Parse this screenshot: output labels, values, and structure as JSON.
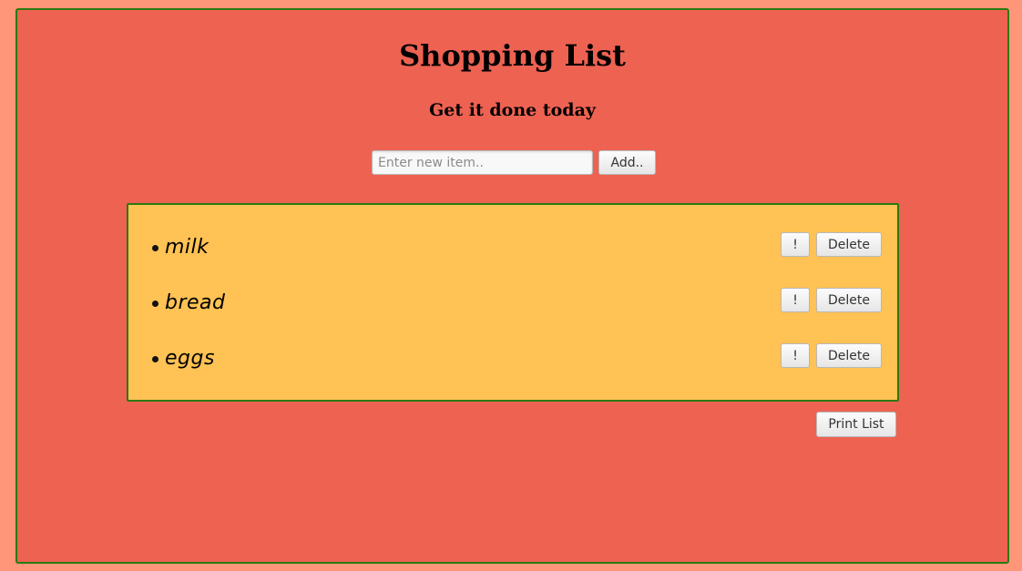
{
  "header": {
    "title": "Shopping List",
    "subtitle": "Get it done today"
  },
  "form": {
    "input_placeholder": "Enter new item..",
    "input_value": "",
    "add_label": "Add.."
  },
  "items": [
    {
      "text": "milk",
      "important_label": "!",
      "delete_label": "Delete"
    },
    {
      "text": "bread",
      "important_label": "!",
      "delete_label": "Delete"
    },
    {
      "text": "eggs",
      "important_label": "!",
      "delete_label": "Delete"
    }
  ],
  "footer": {
    "print_label": "Print List"
  },
  "colors": {
    "page_background": "#ff967a",
    "app_background": "#ee6252",
    "list_background": "#ffc254",
    "border": "#2a7a12"
  }
}
